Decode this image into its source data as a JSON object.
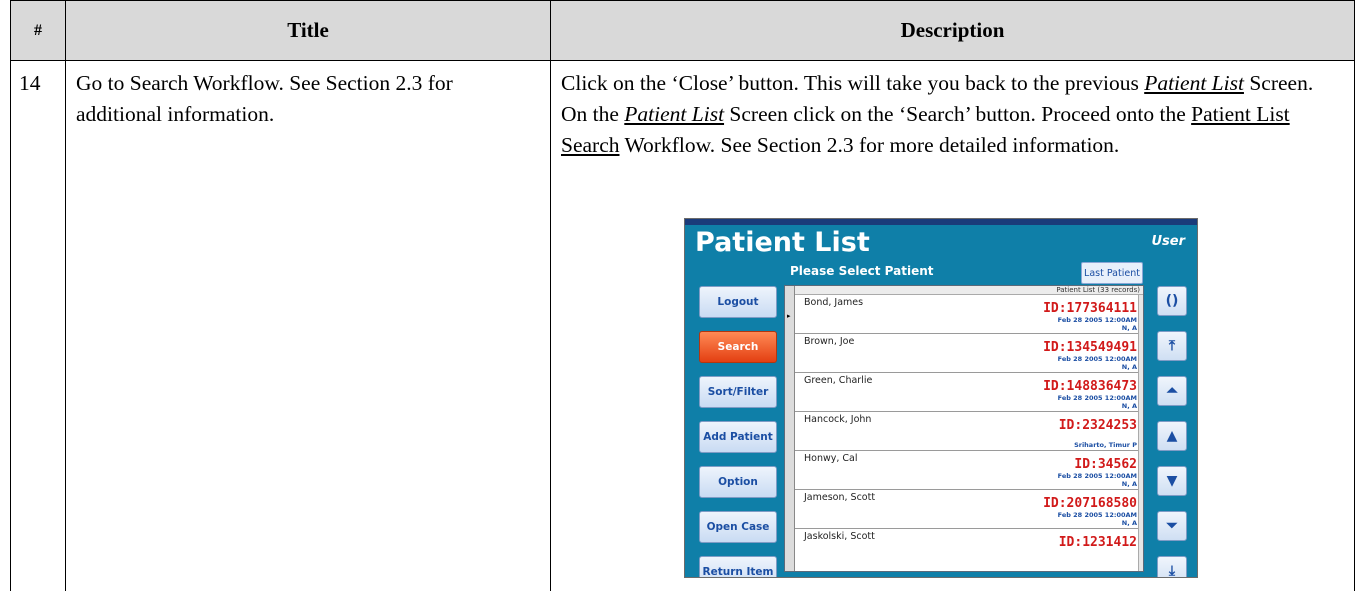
{
  "table": {
    "headers": {
      "num": "#",
      "title": "Title",
      "description": "Description"
    },
    "row": {
      "num": "14",
      "title": "Go to Search Workflow.  See Section 2.3 for additional information.",
      "desc_p1": "Click on the ‘Close’ button.  This will take you back to the previous ",
      "desc_em1": "Patient List",
      "desc_p2": " Screen.  On the ",
      "desc_em2": "Patient List",
      "desc_p3": " Screen click on the ‘Search’ button.  Proceed onto the ",
      "desc_u1": "Patient List Search",
      "desc_p4": " Workflow.  See Section 2.3 for more detailed information."
    }
  },
  "screenshot": {
    "title": "Patient List",
    "user": "User",
    "subtitle": "Please Select Patient",
    "last_patient": "Last Patient",
    "list_header": "Patient List (33 records)",
    "side_buttons": [
      "Logout",
      "Search",
      "Sort/Filter",
      "Add Patient",
      "Option",
      "Open Case",
      "Return Item"
    ],
    "active_button": "Search",
    "patients": [
      {
        "name": "Bond, James",
        "id": "ID:177364111",
        "date": "Feb 28 2005 12:00AM",
        "sub": "N, A"
      },
      {
        "name": "Brown, Joe",
        "id": "ID:134549491",
        "date": "Feb 28 2005 12:00AM",
        "sub": "N, A"
      },
      {
        "name": "Green, Charlie",
        "id": "ID:148836473",
        "date": "Feb 28 2005 12:00AM",
        "sub": "N, A"
      },
      {
        "name": "Hancock, John",
        "id": "ID:2324253",
        "date": "",
        "sub": "Sriharto, Timur P"
      },
      {
        "name": "Honwy, Cal",
        "id": "ID:34562",
        "date": "Feb 28 2005 12:00AM",
        "sub": "N, A"
      },
      {
        "name": "Jameson, Scott",
        "id": "ID:207168580",
        "date": "Feb 28 2005 12:00AM",
        "sub": "N, A"
      },
      {
        "name": "Jaskolski, Scott",
        "id": "ID:1231412",
        "date": "",
        "sub": ""
      }
    ],
    "nav_icons": [
      "refresh-icon",
      "first-page-icon",
      "page-up-icon",
      "line-up-icon",
      "line-down-icon",
      "page-down-icon",
      "last-page-icon"
    ],
    "nav_glyphs": [
      "()",
      "⤒",
      "⏶",
      "▲",
      "▼",
      "⏷",
      "⤓"
    ]
  }
}
